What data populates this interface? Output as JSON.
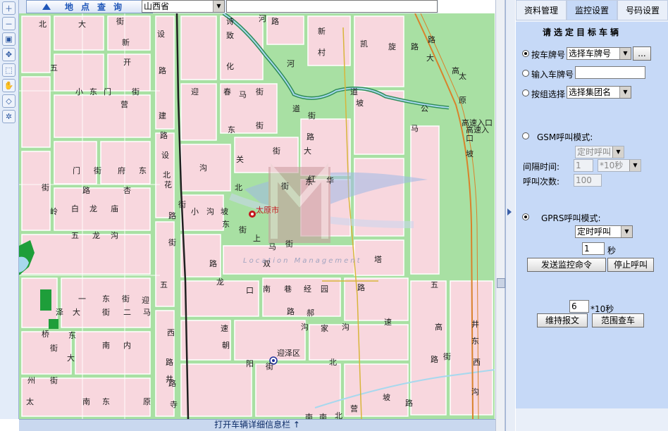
{
  "toolbar": {
    "icons": [
      "zoom-in-icon",
      "zoom-out-icon",
      "full-extent-icon",
      "pan-icon",
      "select-icon",
      "hand-icon",
      "measure-icon",
      "settings-icon"
    ]
  },
  "query": {
    "button_label": "地点查询",
    "province_value": "山西省",
    "search_value": ""
  },
  "map": {
    "city_name": "太原市",
    "district_name": "迎泽区",
    "watermark": "Location Management",
    "labels": [
      "北",
      "大",
      "街",
      "设",
      "新",
      "开",
      "五",
      "路",
      "小",
      "东",
      "门",
      "街",
      "营",
      "建",
      "路",
      "设",
      "北",
      "路",
      "迎",
      "春",
      "街",
      "马",
      "街",
      "路",
      "诗",
      "化",
      "致",
      "河",
      "新",
      "村",
      "凯",
      "旋",
      "路",
      "河",
      "道",
      "坡",
      "公",
      "路",
      "大",
      "高",
      "太",
      "原",
      "高速入口",
      "高速入口",
      "坡",
      "马",
      "道",
      "街",
      "路",
      "东",
      "关",
      "街",
      "大",
      "红",
      "沟",
      "北",
      "街",
      "东",
      "华",
      "门",
      "街",
      "府",
      "东",
      "街",
      "路",
      "杏",
      "花",
      "岭",
      "白",
      "龙",
      "庙",
      "街",
      "小",
      "沟",
      "坡",
      "东",
      "街",
      "上",
      "马",
      "街",
      "五",
      "龙",
      "沟",
      "街",
      "路",
      "双",
      "塔",
      "五",
      "龙",
      "口",
      "南",
      "巷",
      "经",
      "园",
      "路",
      "五",
      "一",
      "东",
      "街",
      "迎",
      "泽",
      "大",
      "街",
      "二",
      "马",
      "路",
      "郝",
      "家",
      "沟",
      "沟",
      "速",
      "高",
      "井",
      "东",
      "桥",
      "东",
      "街",
      "南",
      "内",
      "大",
      "西",
      "速",
      "朝",
      "阳",
      "街",
      "北",
      "路",
      "路",
      "井",
      "州",
      "街",
      "南",
      "东",
      "太",
      "原",
      "路",
      "寺",
      "西",
      "沟",
      "街",
      "南",
      "南",
      "北",
      "营",
      "坡",
      "路"
    ]
  },
  "bottom_bar": {
    "label": "打开车辆详细信息栏 ↑"
  },
  "panel": {
    "tabs": [
      {
        "label": "资料管理",
        "active": false
      },
      {
        "label": "监控设置",
        "active": true
      },
      {
        "label": "号码设置",
        "active": false
      }
    ],
    "heading": "请选定目标车辆",
    "target": {
      "by_plate_label": "按车牌号",
      "plate_select_value": "选择车牌号",
      "ellipsis_label": "...",
      "enter_plate_label": "输入车牌号",
      "enter_plate_value": "",
      "by_group_label": "按组选择",
      "group_select_value": "选择集团名"
    },
    "gsm": {
      "mode_label": "GSM呼叫模式:",
      "mode_value": "定时呼叫",
      "interval_label": "间隔时间:",
      "interval_value": "1",
      "interval_unit_value": "*10秒",
      "count_label": "呼叫次数:",
      "count_value": "100"
    },
    "gprs": {
      "mode_label": "GPRS呼叫模式:",
      "mode_value": "定时呼叫",
      "seconds_value": "1",
      "seconds_unit": "秒",
      "send_label": "发送监控命令",
      "stop_label": "停止呼叫"
    },
    "report": {
      "interval_value": "6",
      "interval_unit": "*10秒",
      "keep_label": "维持报文",
      "range_label": "范围查车"
    }
  },
  "colors": {
    "map_block": "#f8d7de",
    "map_road": "#a8e0a3",
    "panel_bg": "#c6d9f7",
    "tab_active": "#c6d9f7",
    "river": "#2e8b57",
    "city_label": "#c4161c"
  }
}
